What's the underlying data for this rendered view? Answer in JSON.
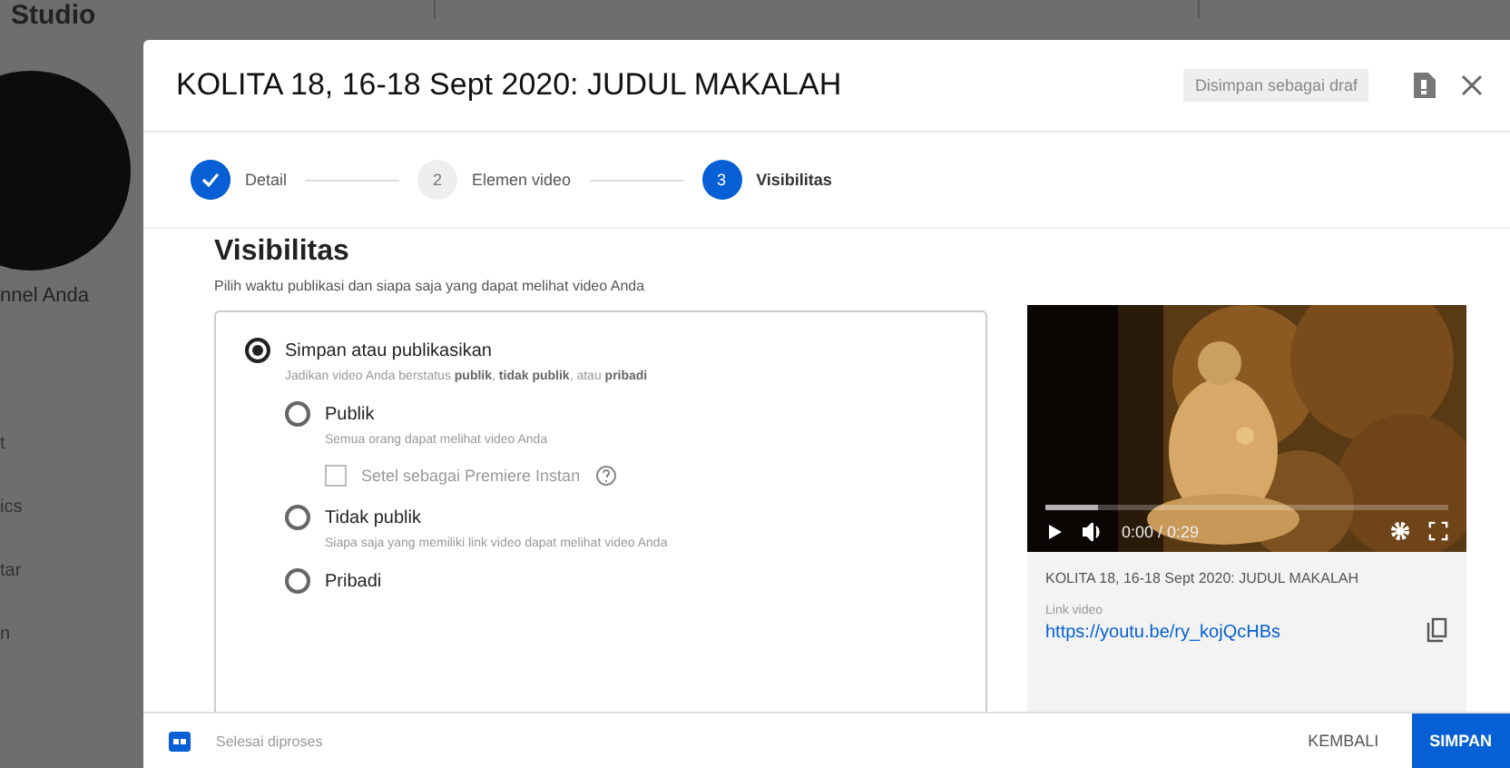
{
  "background": {
    "brand": "Studio",
    "channel_name": "nnel Anda",
    "nav_items": [
      "t",
      "ics",
      "tar",
      "n"
    ]
  },
  "dialog": {
    "title": "KOLITA 18, 16-18 Sept 2020: JUDUL MAKALAH",
    "draft_badge": "Disimpan sebagai draf",
    "steps": [
      {
        "label": "Detail",
        "done": true,
        "selected": false
      },
      {
        "label": "Elemen video",
        "number": "2",
        "done": false,
        "selected": false
      },
      {
        "label": "Visibilitas",
        "number": "3",
        "done": false,
        "selected": true
      }
    ],
    "heading": "Visibilitas",
    "subheading": "Pilih waktu publikasi dan siapa saja yang dapat melihat video Anda",
    "save_option": {
      "label": "Simpan atau publikasikan",
      "description": "Jadikan video Anda berstatus **publik**, **tidak publik**, atau **pribadi**",
      "selected": true,
      "options": [
        {
          "kind": "radio",
          "label": "Publik",
          "description": "Semua orang dapat melihat video Anda",
          "selected": false,
          "premiere": {
            "label": "Setel sebagai Premiere Instan",
            "checked": false,
            "disabled": true
          }
        },
        {
          "kind": "radio",
          "label": "Tidak publik",
          "description": "Siapa saja yang memiliki link video dapat melihat video Anda",
          "selected": false
        },
        {
          "kind": "radio",
          "label": "Pribadi",
          "selected": false
        }
      ]
    },
    "preview": {
      "progress": {
        "level": 0.13
      },
      "time": "0:00 / 0:29",
      "video_title": "KOLITA 18, 16-18 Sept 2020: JUDUL MAKALAH",
      "link_label": "Link video",
      "link": "https://youtu.be/ry_kojQcHBs"
    },
    "footer": {
      "status": "Selesai diproses",
      "back": "KEMBALI",
      "save": "SIMPAN"
    }
  }
}
